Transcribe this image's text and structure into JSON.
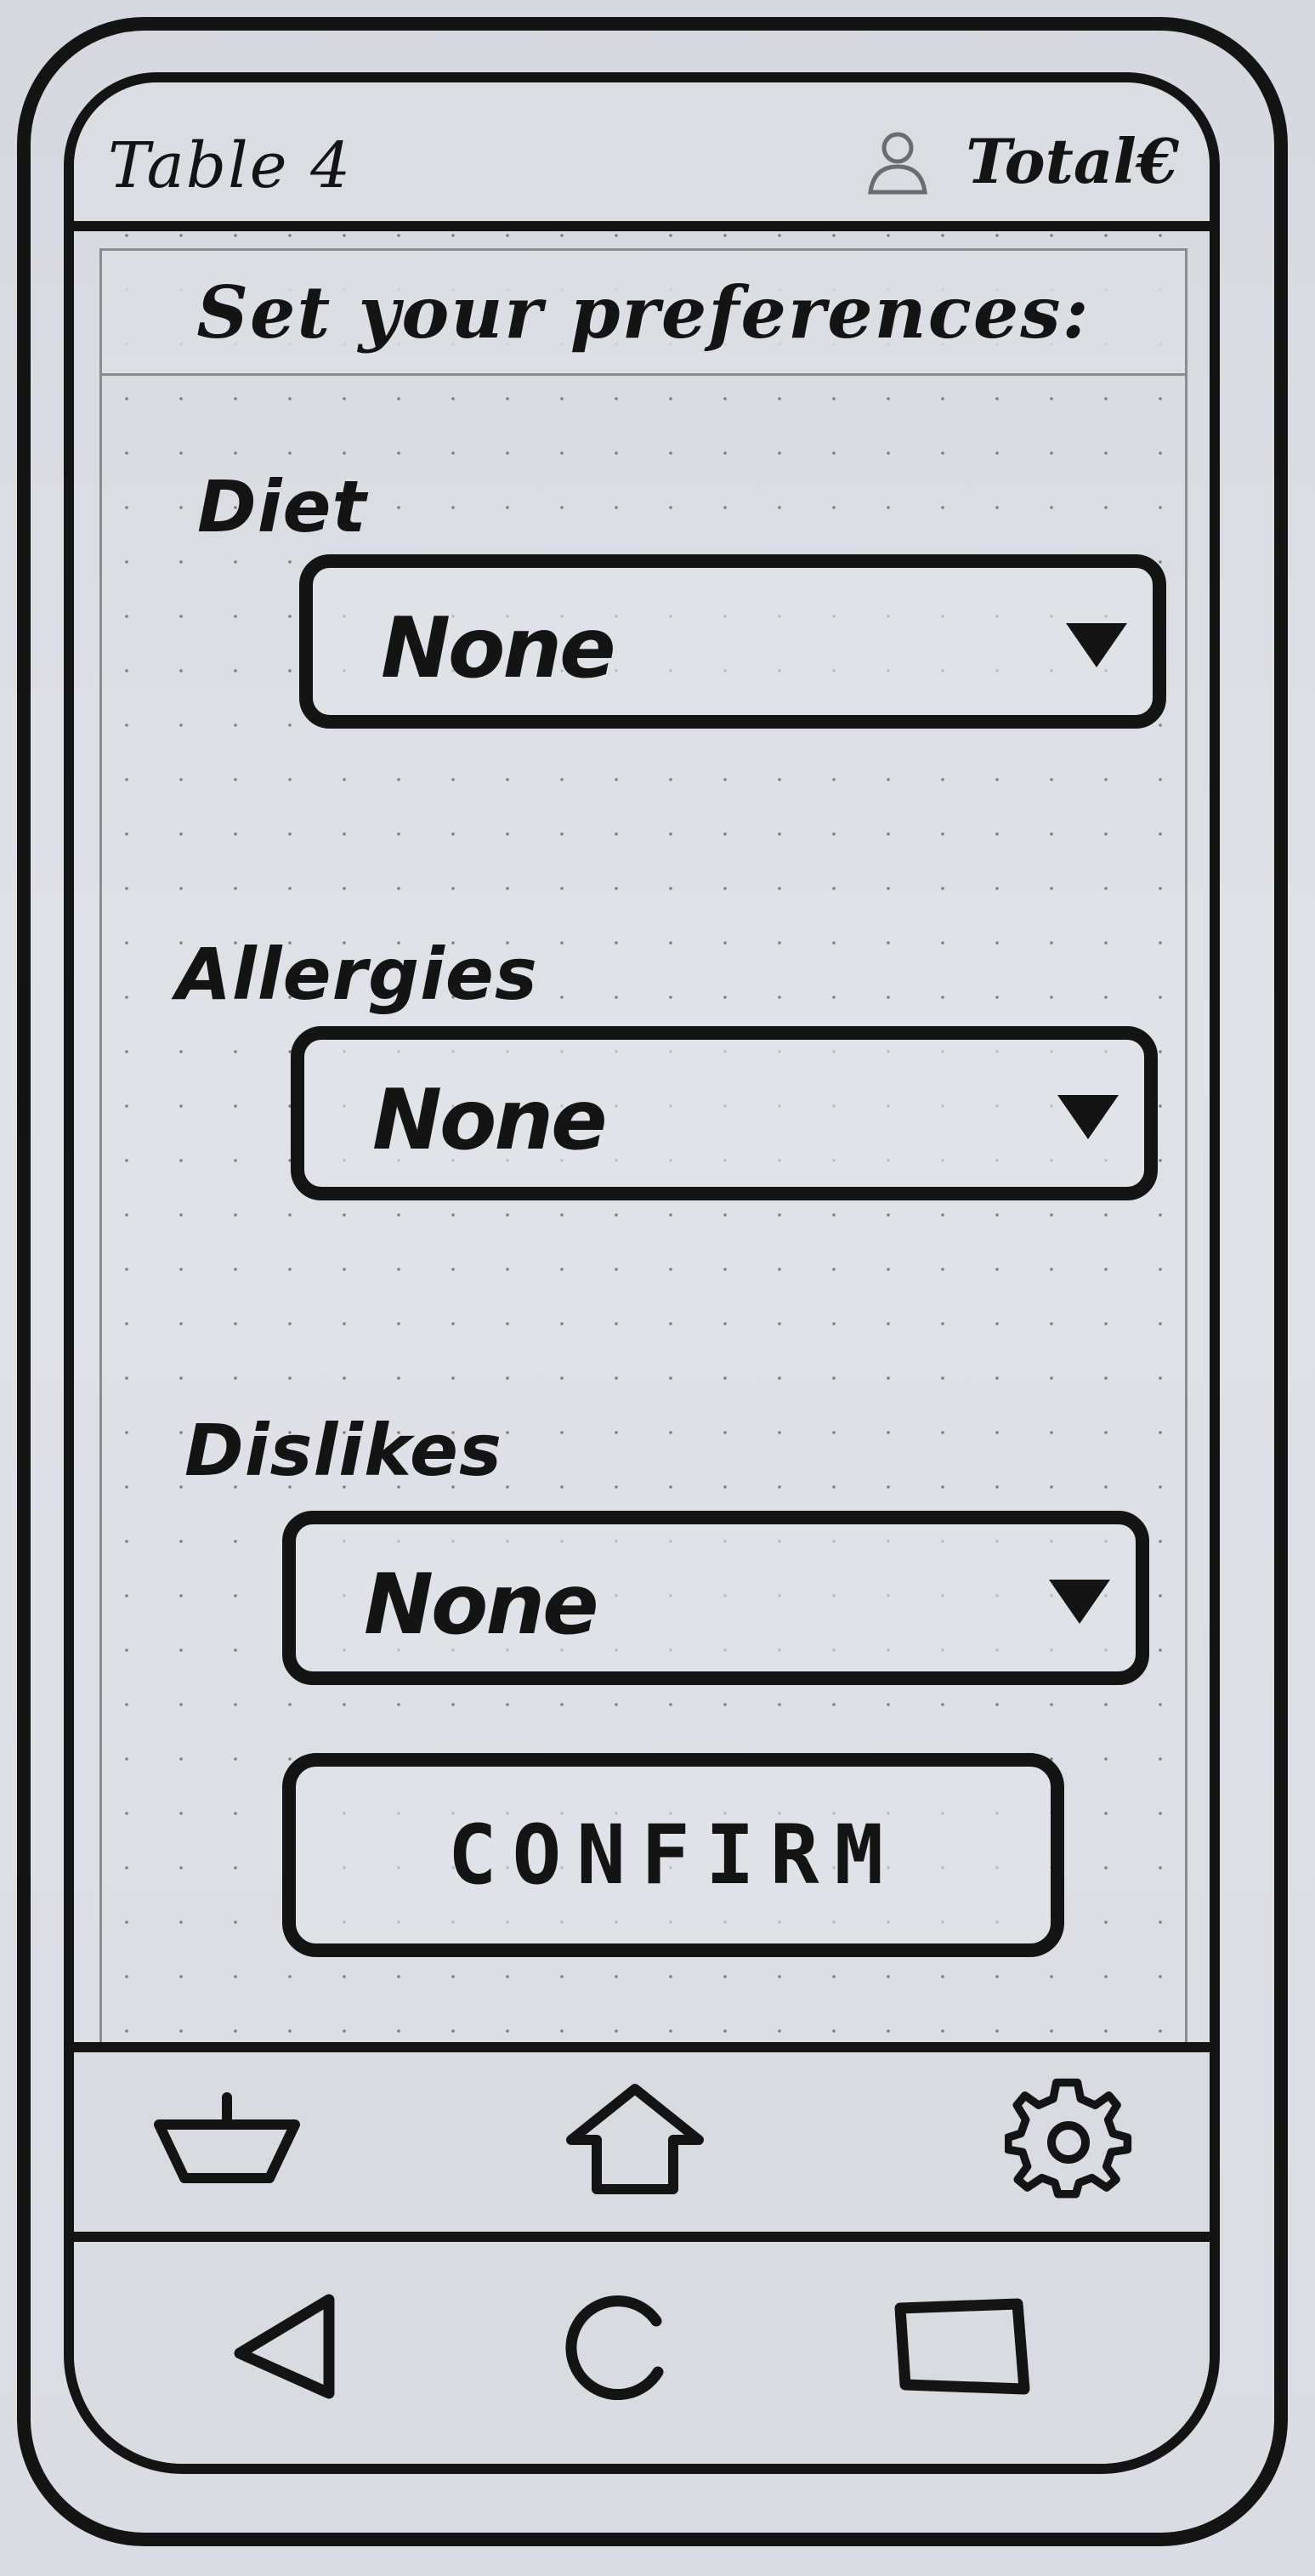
{
  "status_bar": {
    "table_label": "Table 4",
    "user_icon": "user-icon",
    "total_label": "Total€"
  },
  "header": {
    "title": "Set your preferences:"
  },
  "form": {
    "fields": [
      {
        "label": "Diet",
        "value": "None",
        "icon": "dropdown-arrow-icon"
      },
      {
        "label": "Allergies",
        "value": "None",
        "icon": "dropdown-arrow-icon"
      },
      {
        "label": "Dislikes",
        "value": "None",
        "icon": "dropdown-arrow-icon"
      }
    ],
    "confirm_label": "CONFIRM"
  },
  "app_nav": [
    {
      "icon": "basket-icon"
    },
    {
      "icon": "home-icon"
    },
    {
      "icon": "gear-icon"
    }
  ],
  "system_nav": [
    {
      "icon": "back-icon"
    },
    {
      "icon": "home-circle-icon"
    },
    {
      "icon": "recents-icon"
    }
  ],
  "colors": {
    "ink": "#141414",
    "paper": "#dadde2"
  }
}
